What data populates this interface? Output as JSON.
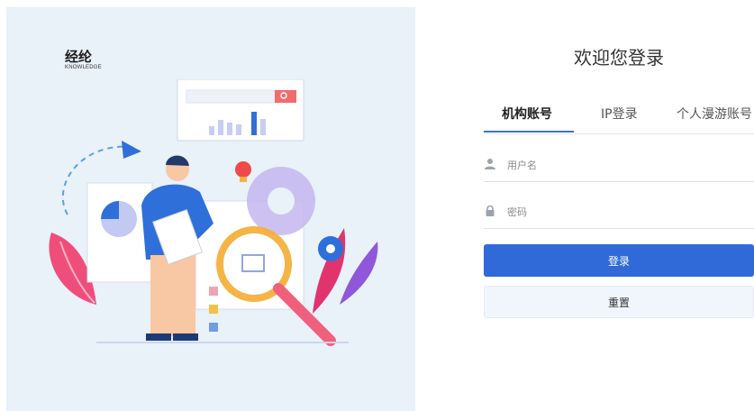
{
  "brand": {
    "name": "经纶",
    "sub": "KNOWLEDGE",
    "accent": "#e8352b"
  },
  "login": {
    "title": "欢迎您登录",
    "tabs": [
      {
        "label": "机构账号",
        "active": true
      },
      {
        "label": "IP登录",
        "active": false
      },
      {
        "label": "个人漫游账号",
        "active": false
      }
    ],
    "username_placeholder": "用户名",
    "password_placeholder": "密码",
    "login_button": "登录",
    "reset_button": "重置"
  },
  "colors": {
    "primary": "#2f6ad8",
    "left_bg": "#e9f1f9"
  }
}
